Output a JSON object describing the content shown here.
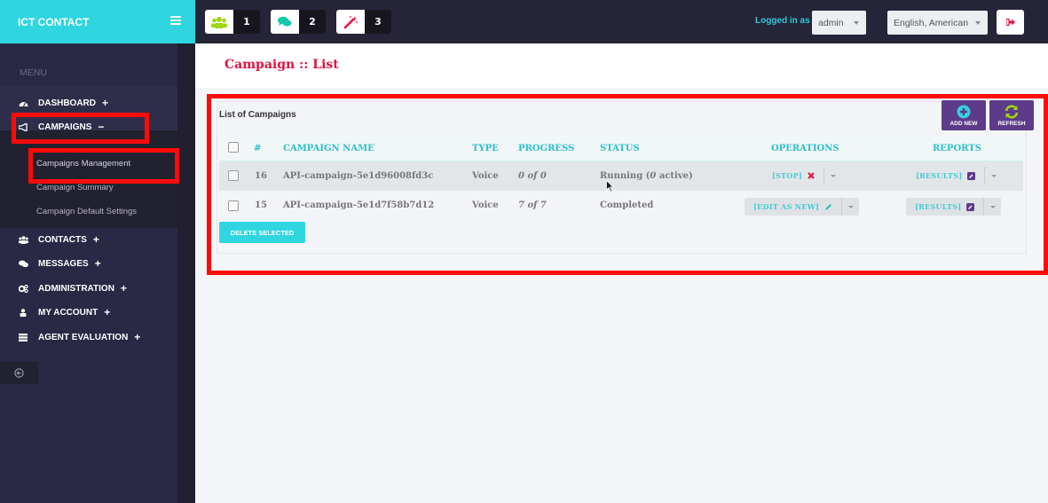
{
  "header": {
    "brand": "ICT CONTACT",
    "menu_toggle_icon": "hamburger-icon",
    "notifications": [
      {
        "icon": "users-icon",
        "count": "1",
        "color": "#9ed613"
      },
      {
        "icon": "chat-icon",
        "count": "2",
        "color": "#14c9a9"
      },
      {
        "icon": "magic-wand-icon",
        "count": "3",
        "color": "#e8133f"
      }
    ],
    "logged_in_label": "Logged in as :",
    "user_select": {
      "value": "admin"
    },
    "language_select": {
      "value": "English, American"
    },
    "logout_icon": "sign-out-icon"
  },
  "sidebar": {
    "menu_label": "MENU",
    "items": [
      {
        "label": "DASHBOARD",
        "icon": "dashboard-icon",
        "toggle": "+"
      },
      {
        "label": "CAMPAIGNS",
        "icon": "bullhorn-icon",
        "toggle": "−"
      },
      {
        "label": "CONTACTS",
        "icon": "users-icon",
        "toggle": "+"
      },
      {
        "label": "MESSAGES",
        "icon": "comments-icon",
        "toggle": "+"
      },
      {
        "label": "ADMINISTRATION",
        "icon": "cogs-icon",
        "toggle": "+"
      },
      {
        "label": "MY ACCOUNT",
        "icon": "user-icon",
        "toggle": "+"
      },
      {
        "label": "AGENT EVALUATION",
        "icon": "server-icon",
        "toggle": "+"
      }
    ],
    "campaigns_submenu": [
      {
        "label": "Campaigns Management",
        "active": true
      },
      {
        "label": "Campaign Summary"
      },
      {
        "label": "Campaign Default Settings"
      }
    ],
    "collapse_icon": "arrow-circle-left-icon"
  },
  "page": {
    "title": "Campaign :: List",
    "panel_title": "List of Campaigns",
    "add_new_label": "ADD NEW",
    "refresh_label": "REFRESH",
    "delete_selected_label": "DELETE SELECTED"
  },
  "table": {
    "columns": [
      "#",
      "CAMPAIGN NAME",
      "TYPE",
      "PROGRESS",
      "STATUS",
      "OPERATIONS",
      "REPORTS"
    ],
    "rows": [
      {
        "id": "16",
        "name": "API-campaign-5e1d96008fd3c",
        "type": "Voice",
        "progress": "0 of 0",
        "status_prefix": "Running (",
        "status_active": "0",
        "status_suffix": " active)",
        "operation": "[STOP]",
        "operation_icon": "times-icon",
        "report": "[RESULTS]",
        "report_icon": "edit-icon"
      },
      {
        "id": "15",
        "name": "API-campaign-5e1d7f58b7d12",
        "type": "Voice",
        "progress": "7 of 7",
        "status_prefix": "Completed",
        "status_active": "",
        "status_suffix": "",
        "operation": "[EDIT AS NEW]",
        "operation_icon": "pencil-icon",
        "report": "[RESULTS]",
        "report_icon": "edit-icon"
      }
    ]
  },
  "colors": {
    "brand": "#2fd6e0",
    "topbar": "#262438",
    "sidebar": "#292845",
    "accent_purple": "#5d3b8a",
    "title_red": "#e0133f",
    "table_header": "#2fbfca"
  }
}
